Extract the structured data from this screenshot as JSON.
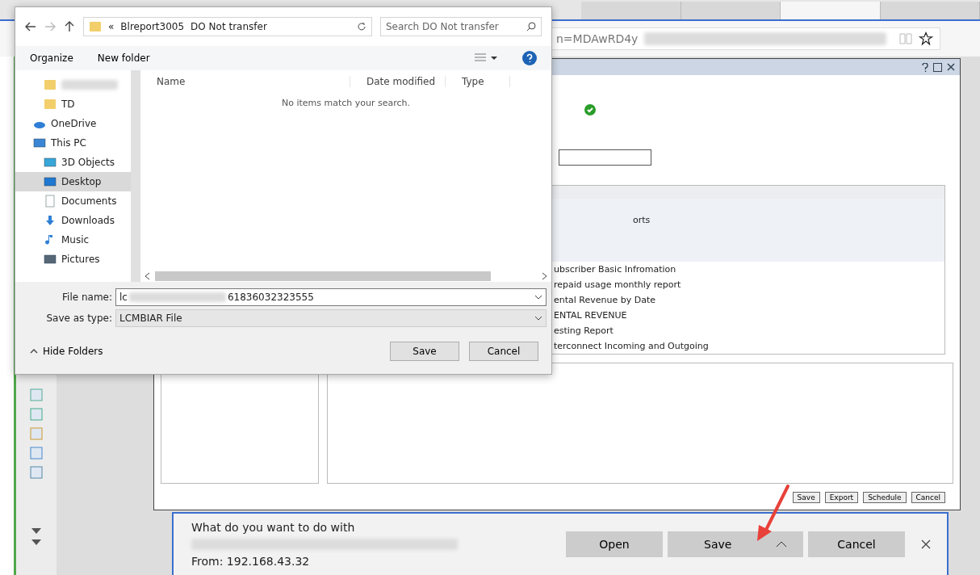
{
  "browser": {
    "tabs": [
      {
        "selected": false
      },
      {
        "selected": false
      },
      {
        "selected": true
      },
      {
        "selected": false
      }
    ],
    "address": "n=MDAwRD4y"
  },
  "report_dialog": {
    "items": [
      {
        "text": "orts",
        "selected": true
      },
      {
        "text": "ubscriber Basic Infromation",
        "selected": false
      },
      {
        "text": "repaid usage monthly report",
        "selected": false
      },
      {
        "text": "ental Revenue by Date",
        "selected": false
      },
      {
        "text": "ENTAL REVENUE",
        "selected": false
      },
      {
        "text": "esting Report",
        "selected": false
      },
      {
        "text": "terconnect Incoming and Outgoing",
        "selected": false
      }
    ],
    "buttons": [
      "Save",
      "Export",
      "Schedule",
      "Cancel"
    ]
  },
  "save_dialog": {
    "path": [
      "«",
      "Blreport3005",
      "DO Not transfer"
    ],
    "search": {
      "placeholder": "Search DO Not transfer"
    },
    "toolbar": [
      "Organize",
      "New folder"
    ],
    "columns": [
      "Name",
      "Date modified",
      "Type"
    ],
    "empty_message": "No items match your search.",
    "tree": [
      {
        "children": [
          {
            "kind": "folder",
            "selected": false
          },
          {
            "kind": "folder",
            "label": "TD",
            "selected": false
          }
        ]
      },
      {
        "kind": "cloud",
        "label": "OneDrive",
        "selected": false
      },
      {
        "kind": "pc",
        "label": "This PC",
        "selected": false,
        "children": [
          {
            "kind": "cube",
            "label": "3D Objects",
            "selected": false
          },
          {
            "kind": "desktop",
            "label": "Desktop",
            "selected": true
          },
          {
            "kind": "documents",
            "label": "Documents",
            "selected": false
          },
          {
            "kind": "downloads",
            "label": "Downloads",
            "selected": false
          },
          {
            "kind": "music",
            "label": "Music",
            "selected": false
          },
          {
            "kind": "pictures",
            "label": "Pictures",
            "selected": false
          }
        ]
      }
    ],
    "file_name": {
      "label": "File name:",
      "prefix": "lc",
      "suffix": "61836032323555"
    },
    "save_as_type": {
      "label": "Save as type:",
      "value": "LCMBIAR File"
    },
    "hide_folders": "Hide Folders",
    "buttons": [
      "Save",
      "Cancel"
    ]
  },
  "download_bar": {
    "prompt": "What do you want to do with",
    "source": "From: 192.168.43.32",
    "buttons": [
      "Open",
      "Save",
      "Cancel"
    ]
  }
}
